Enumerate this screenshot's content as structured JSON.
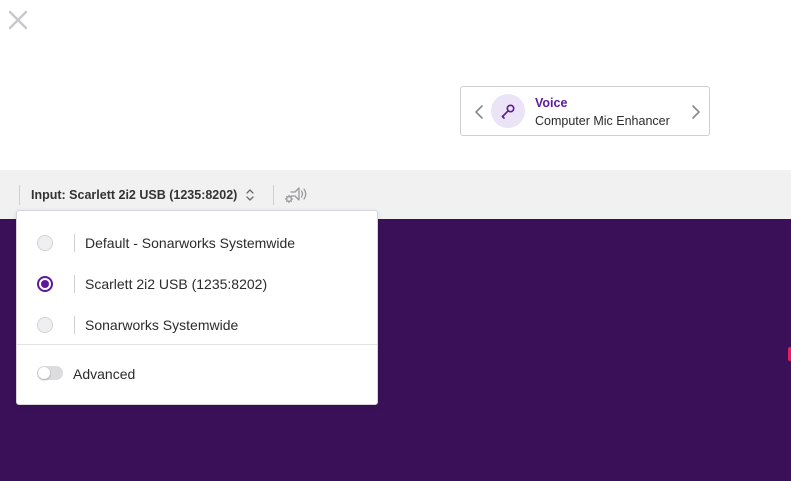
{
  "preset": {
    "title": "Voice",
    "subtitle": "Computer Mic Enhancer",
    "icon": "microphone-icon"
  },
  "toolbar": {
    "input_label": "Input: Scarlett 2i2 USB (1235:8202)"
  },
  "dropdown": {
    "options": [
      {
        "label": "Default - Sonarworks Systemwide",
        "selected": false
      },
      {
        "label": "Scarlett 2i2 USB (1235:8202)",
        "selected": true
      },
      {
        "label": "Sonarworks Systemwide",
        "selected": false
      }
    ],
    "advanced_label": "Advanced",
    "advanced_enabled": false
  },
  "colors": {
    "accent": "#5b1a9b",
    "background_purple": "#3a1159",
    "toolbar_bg": "#f1f1f2"
  }
}
